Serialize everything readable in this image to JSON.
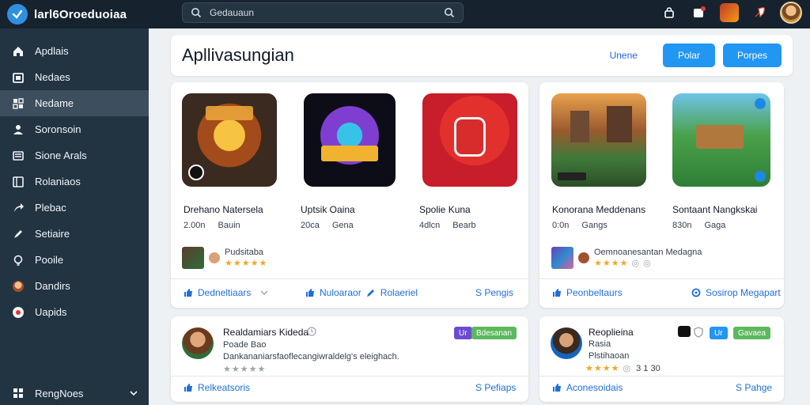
{
  "topbar": {
    "brand_name": "larl6Oroeduoiaa",
    "search_text": "Gedauaun"
  },
  "sidebar": {
    "items": [
      {
        "label": "Apdlais",
        "icon": "home-icon"
      },
      {
        "label": "Nedaes",
        "icon": "calendar-icon"
      },
      {
        "label": "Nedame",
        "icon": "grid-icon"
      },
      {
        "label": "Soronsoin",
        "icon": "user-icon"
      },
      {
        "label": "Sione Arals",
        "icon": "list-icon"
      },
      {
        "label": "Rolaniaos",
        "icon": "book-icon"
      },
      {
        "label": "Plebac",
        "icon": "share-icon"
      },
      {
        "label": "Setiaire",
        "icon": "pen-icon"
      },
      {
        "label": "Pooile",
        "icon": "bulb-icon"
      },
      {
        "label": "Dandirs",
        "icon": "avatar-icon"
      },
      {
        "label": "Uapids",
        "icon": "pin-icon"
      }
    ],
    "active_index": 2,
    "footer_label": "RengNoes"
  },
  "header": {
    "title": "Apllivasungian",
    "link_label": "Unene",
    "button1": "Polar",
    "button2": "Porpes"
  },
  "cards": {
    "left_top": {
      "apps": [
        {
          "name": "Drehano Natersela",
          "size": "2.00n",
          "tag": "Bauin"
        },
        {
          "name": "Uptsik Oaina",
          "size": "20ca",
          "tag": "Gena"
        },
        {
          "name": "Spolie Kuna",
          "size": "4dlcn",
          "tag": "Bearb"
        }
      ],
      "review_text": "Pudsitaba",
      "footer": {
        "link1": "Dedneltiaars",
        "link2": "Nuloaraor",
        "link3": "Rolaeriel",
        "link4": "S Pengis"
      }
    },
    "right_top": {
      "apps": [
        {
          "name": "Konorana Meddenans",
          "size": "0:0n",
          "tag": "Gangs"
        },
        {
          "name": "Sontaant Nangkskai",
          "size": "830n",
          "tag": "Gaga"
        }
      ],
      "review_text": "Oemnoanesantan Medagna",
      "footer": {
        "link1": "Peonbeltaurs",
        "link2": "Sosirop Megapart"
      }
    },
    "left_bottom": {
      "person_name": "Realdamiars Kideda",
      "person_sub": "Poade  Bao",
      "description": "Dankananiarsfaoflecangiwraldelg's eleighach.",
      "badge1": "Ur",
      "badge2": "Bdesanan",
      "footer": {
        "link1": "Relkeatsoris",
        "link2": "S Pefiaps"
      }
    },
    "right_bottom": {
      "person_name": "Reoplieina",
      "person_sub": "Rasia",
      "person_sub2": "Plstihaoan",
      "rating_text": "3 1 30",
      "badge1": "Ur",
      "badge2": "Gavaea",
      "footer": {
        "link1": "Aconesoidais",
        "link2": "S Pahge"
      }
    }
  },
  "colors": {
    "topbar": "#16232e",
    "sidebar": "#223342",
    "sidebar_active": "#3d4f5e",
    "accent": "#2196f3",
    "link": "#1f6fd6",
    "badge_green": "#5cb85c",
    "badge_purple": "#6c4bd1",
    "badge_blue": "#2196f3"
  }
}
